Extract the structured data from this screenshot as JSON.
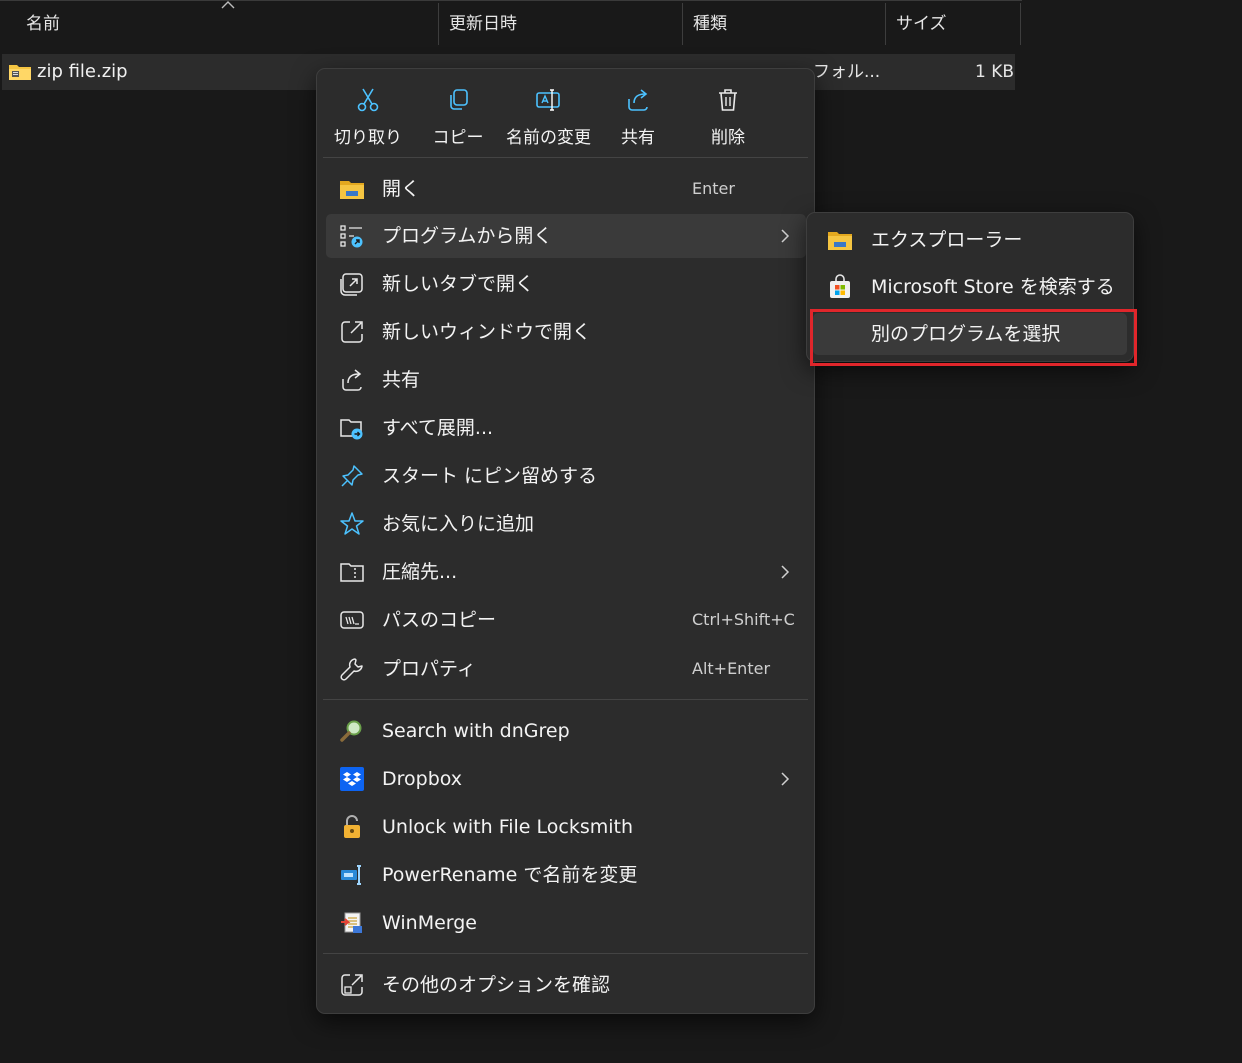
{
  "columns": {
    "name": "名前",
    "modified": "更新日時",
    "type": "種類",
    "size": "サイズ"
  },
  "file": {
    "name": "zip file.zip",
    "type_partial": "フォル...",
    "size": "1 KB"
  },
  "quick_actions": [
    {
      "label": "切り取り",
      "icon": "scissors-icon"
    },
    {
      "label": "コピー",
      "icon": "copy-icon"
    },
    {
      "label": "名前の変更",
      "icon": "rename-icon"
    },
    {
      "label": "共有",
      "icon": "share-icon"
    },
    {
      "label": "削除",
      "icon": "trash-icon"
    }
  ],
  "menu_items": [
    {
      "label": "開く",
      "shortcut": "Enter",
      "icon": "folder-icon"
    },
    {
      "label": "プログラムから開く",
      "icon": "open-with-icon",
      "has_submenu": true
    },
    {
      "label": "新しいタブで開く",
      "icon": "new-tab-icon"
    },
    {
      "label": "新しいウィンドウで開く",
      "icon": "new-window-icon"
    },
    {
      "label": "共有",
      "icon": "share-icon"
    },
    {
      "label": "すべて展開...",
      "icon": "extract-icon"
    },
    {
      "label": "スタート にピン留めする",
      "icon": "pin-icon"
    },
    {
      "label": "お気に入りに追加",
      "icon": "star-icon"
    },
    {
      "label": "圧縮先...",
      "icon": "compress-icon",
      "has_submenu": true
    },
    {
      "label": "パスのコピー",
      "shortcut": "Ctrl+Shift+C",
      "icon": "copy-path-icon"
    },
    {
      "label": "プロパティ",
      "shortcut": "Alt+Enter",
      "icon": "wrench-icon"
    },
    {
      "label": "Search with dnGrep",
      "icon": "dngrep-icon"
    },
    {
      "label": "Dropbox",
      "icon": "dropbox-icon",
      "has_submenu": true
    },
    {
      "label": "Unlock with File Locksmith",
      "icon": "lock-icon"
    },
    {
      "label": "PowerRename で名前を変更",
      "icon": "powerrename-icon"
    },
    {
      "label": "WinMerge",
      "icon": "winmerge-icon"
    },
    {
      "label": "その他のオプションを確認",
      "icon": "more-options-icon"
    }
  ],
  "submenu_items": [
    {
      "label": "エクスプローラー",
      "icon": "explorer-icon"
    },
    {
      "label": "Microsoft Store を検索する",
      "icon": "store-icon"
    },
    {
      "label": "別のプログラムを選択"
    }
  ],
  "colors": {
    "background": "#191919",
    "menu": "#2c2c2c",
    "hover": "#3a3a3a",
    "accent": "#4cc2ff",
    "highlight_border": "#e0262b",
    "folder_yellow": "#f5c542"
  }
}
